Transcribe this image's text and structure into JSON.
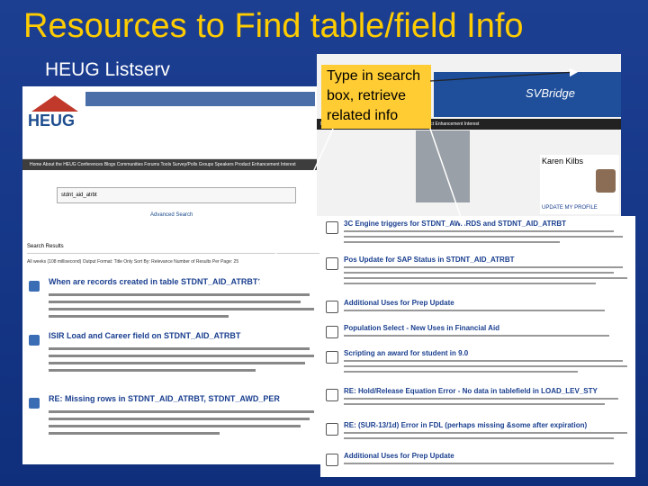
{
  "slide": {
    "title": "Resources to Find table/field Info",
    "subtitle": "HEUG Listserv"
  },
  "callout": {
    "text": "Type in search box, retrieve related info"
  },
  "listserv": {
    "logo_text": "HEUG",
    "nav_items": "Home  About the HEUG  Conferences  Blogs  Communities  Forums  Tools  Survey/Polls  Groups  Speakers  Product Enhancement Interest",
    "search_value": "stdnt_aid_atrbt",
    "advanced_link": "Advanced Search",
    "results_label": "Search Results",
    "filter_text": "All weeks (108 millisecond)   Output Format: Title Only   Sort By: Relevance   Number of Results Per Page: 25",
    "results": [
      {
        "title": "When are records created in table STDNT_AID_ATRBT?"
      },
      {
        "title": "ISIR Load and Career field on STDNT_AID_ATRBT"
      },
      {
        "title": "RE: Missing rows in STDNT_AID_ATRBT, STDNT_AWD_PER"
      }
    ]
  },
  "heug_site": {
    "bridge": "SVBridge",
    "nav_items": "NETWORKING  BLOGS  EVENTS  RESOURCES  Product Enhancement Interest",
    "profile_name": "Karen Kilbs",
    "profile_link": "UPDATE MY PROFILE"
  },
  "forum_results": [
    {
      "title": "3C Engine triggers for STDNT_AWARDS and STDNT_AID_ATRBT"
    },
    {
      "title": "Pos Update for SAP Status in STDNT_AID_ATRBT"
    },
    {
      "title": "Additional Uses for Prep Update"
    },
    {
      "title": "Population Select - New Uses in Financial Aid"
    },
    {
      "title": "Scripting an award for student in 9.0"
    },
    {
      "title": "RE: Hold/Release Equation Error - No data in tablefield in LOAD_LEV_STY"
    },
    {
      "title": "RE: (SUR-13/1d) Error in FDL (perhaps missing &some after expiration)"
    },
    {
      "title": "Additional Uses for Prep Update"
    }
  ],
  "colors": {
    "title": "#ffcc00",
    "callout": "#ffcc33",
    "link": "#1a3f8f"
  }
}
